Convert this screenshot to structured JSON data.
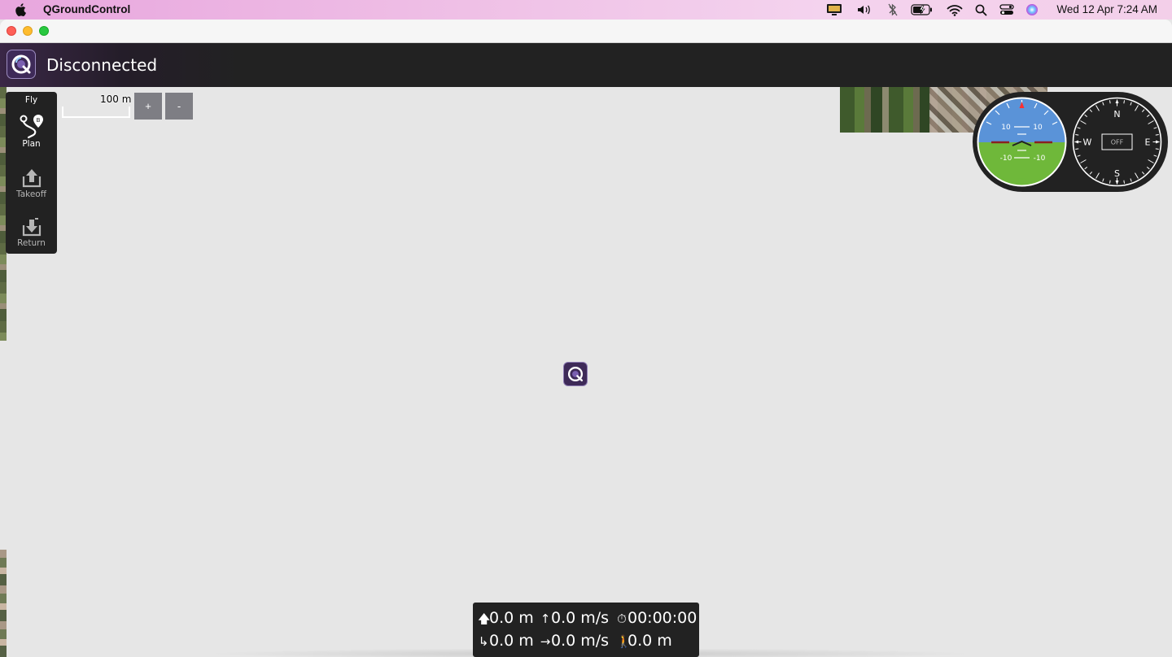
{
  "menubar": {
    "app_name": "QGroundControl",
    "clock": "Wed 12 Apr  7:24 AM",
    "tray_icons": [
      "display-icon",
      "volume-icon",
      "bluetooth-icon",
      "battery-icon",
      "wifi-icon",
      "spotlight-search-icon",
      "control-center-icon",
      "siri-icon"
    ]
  },
  "toolbar": {
    "status": "Disconnected"
  },
  "toolstrip": {
    "items": [
      {
        "label": "Fly",
        "icon": "fly-icon"
      },
      {
        "label": "Plan",
        "icon": "plan-route-icon"
      },
      {
        "label": "Takeoff",
        "icon": "takeoff-icon"
      },
      {
        "label": "Return",
        "icon": "return-icon"
      }
    ]
  },
  "map": {
    "scale_label": "100 m",
    "zoom_in_label": "+",
    "zoom_out_label": "-"
  },
  "attitude": {
    "pitch_labels": [
      "10",
      "10",
      "-10",
      "-10"
    ]
  },
  "compass": {
    "north": "N",
    "east": "E",
    "south": "S",
    "west": "W",
    "heading_box": "OFF"
  },
  "telemetry": {
    "altitude": "0.0 m",
    "vertical_speed": "0.0 m/s",
    "flight_time": "00:00:00",
    "distance": "0.0 m",
    "horizontal_speed": "0.0 m/s",
    "home_distance": "0.0 m"
  },
  "colors": {
    "toolbar_bg": "#222222",
    "sky": "#5a93d8",
    "ground": "#6fb83a",
    "qgc_purple": "#3e2a58"
  }
}
